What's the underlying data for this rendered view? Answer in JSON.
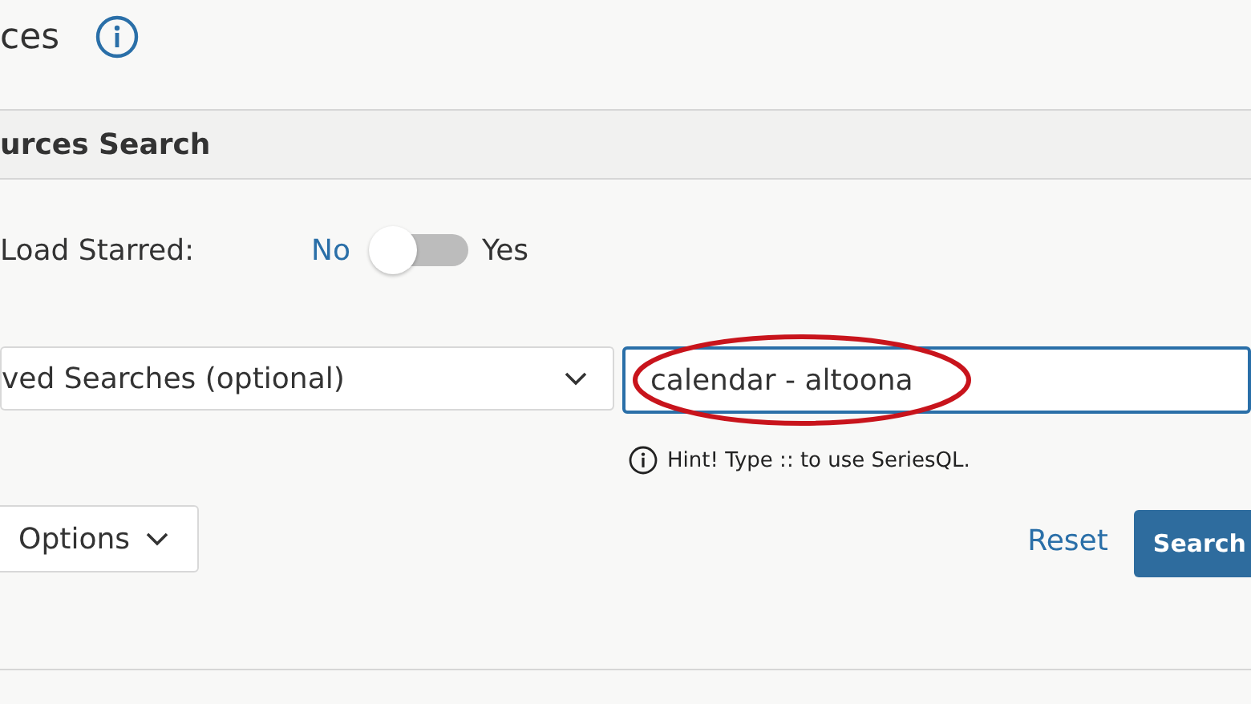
{
  "page": {
    "title": "ces"
  },
  "section": {
    "title": "urces Search"
  },
  "load_starred": {
    "label": "Load Starred:",
    "off_label": "No",
    "on_label": "Yes",
    "on": false
  },
  "saved_searches": {
    "value": "ved Searches (optional)"
  },
  "search": {
    "value": "calendar - altoona",
    "highlighted": true,
    "hint": "Hint! Type :: to use SeriesQL."
  },
  "options_button": "Options",
  "reset_link": "Reset",
  "search_button": "Search"
}
